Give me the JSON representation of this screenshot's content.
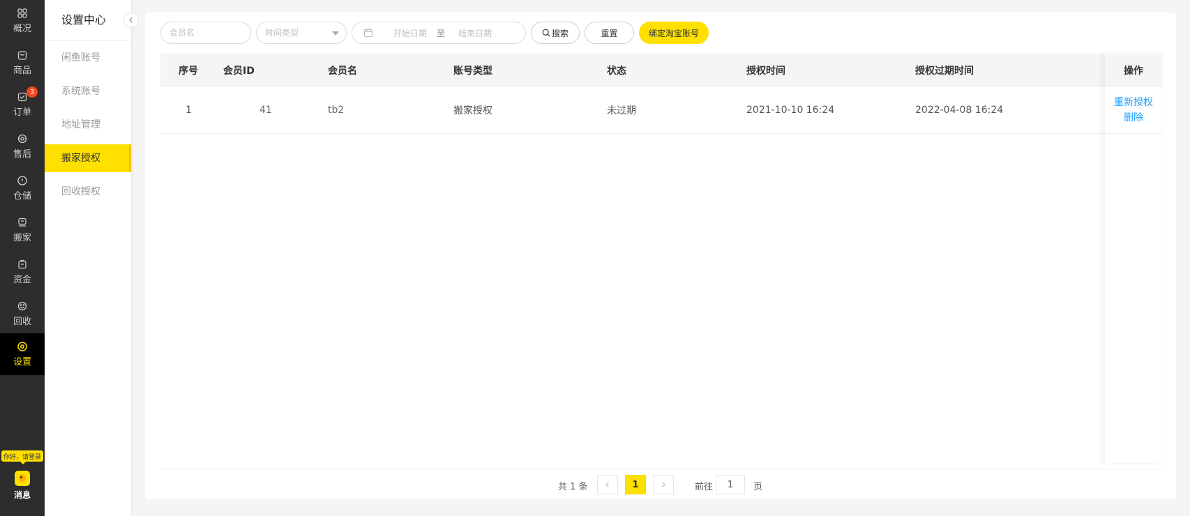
{
  "nav": {
    "items": [
      {
        "label": "概况",
        "icon": "dashboard-icon"
      },
      {
        "label": "商品",
        "icon": "bag-icon"
      },
      {
        "label": "订单",
        "icon": "order-icon",
        "badge": "3"
      },
      {
        "label": "售后",
        "icon": "headset-icon"
      },
      {
        "label": "仓储",
        "icon": "warehouse-icon"
      },
      {
        "label": "搬家",
        "icon": "move-icon"
      },
      {
        "label": "资金",
        "icon": "wallet-icon"
      },
      {
        "label": "回收",
        "icon": "recycle-icon"
      },
      {
        "label": "设置",
        "icon": "settings-icon",
        "active": true
      }
    ],
    "greeting": "你好，请登录",
    "message_label": "消息"
  },
  "sidebar": {
    "title": "设置中心",
    "items": [
      {
        "label": "闲鱼账号"
      },
      {
        "label": "系统账号"
      },
      {
        "label": "地址管理"
      },
      {
        "label": "搬家授权",
        "active": true
      },
      {
        "label": "回收授权"
      }
    ]
  },
  "toolbar": {
    "member_placeholder": "会员名",
    "time_type_placeholder": "时间类型",
    "start_date_placeholder": "开始日期",
    "range_separator": "至",
    "end_date_placeholder": "结束日期",
    "search_label": "搜索",
    "reset_label": "重置",
    "bind_label": "绑定淘宝账号"
  },
  "table": {
    "columns": [
      "序号",
      "会员ID",
      "会员名",
      "账号类型",
      "状态",
      "授权时间",
      "授权过期时间",
      "操作"
    ],
    "rows": [
      {
        "index": "1",
        "member_id": "41",
        "member_name": "tb2",
        "account_type": "搬家授权",
        "status": "未过期",
        "auth_time": "2021-10-10 16:24",
        "expire_time": "2022-04-08 16:24",
        "actions": [
          "重新授权",
          "删除"
        ]
      }
    ]
  },
  "pagination": {
    "total_text": "共 1 条",
    "current_page": "1",
    "goto_label": "前往",
    "goto_value": "1",
    "page_suffix": "页"
  },
  "colors": {
    "accent": "#ffe000",
    "link": "#1e9fff",
    "nav_bg": "#2d2d2d",
    "badge": "#f5461f"
  }
}
